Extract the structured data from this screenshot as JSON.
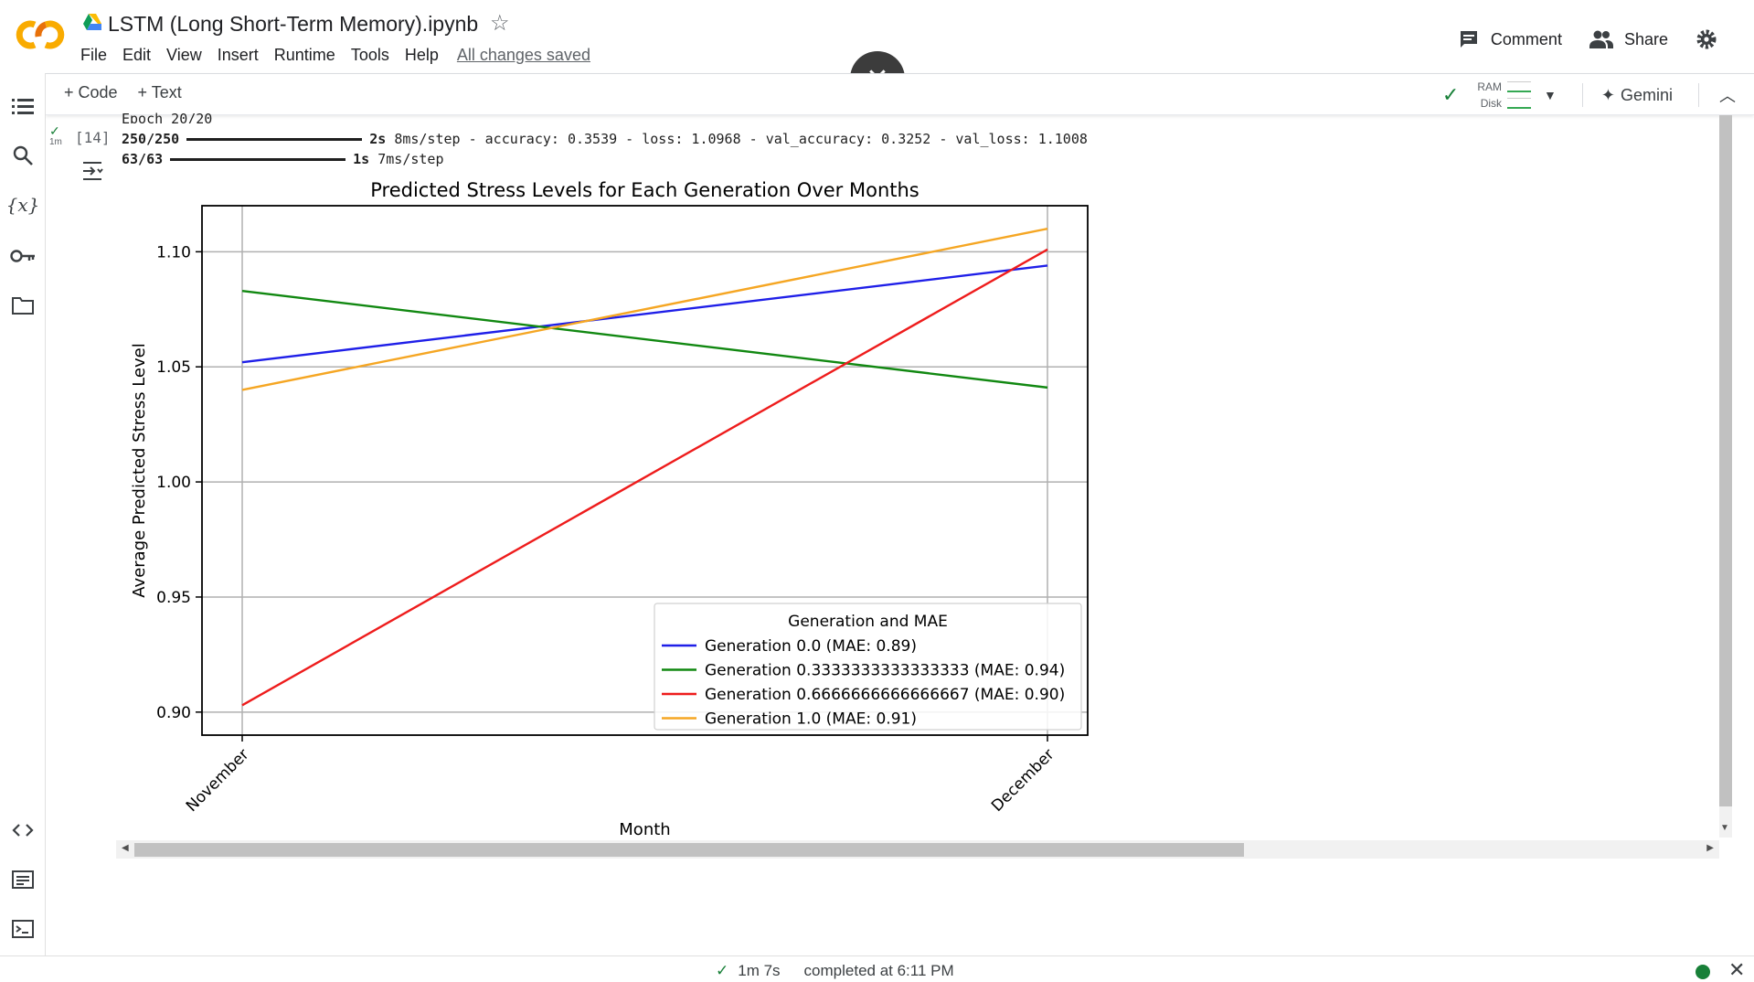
{
  "header": {
    "title": "LSTM (Long Short-Term Memory).ipynb",
    "menu": [
      "File",
      "Edit",
      "View",
      "Insert",
      "Runtime",
      "Tools",
      "Help"
    ],
    "saved_status": "All changes saved",
    "comment_label": "Comment",
    "share_label": "Share"
  },
  "toolbar": {
    "add_code": "+ Code",
    "add_text": "+ Text",
    "ram_label": "RAM",
    "disk_label": "Disk",
    "gemini_label": "Gemini"
  },
  "cell": {
    "run_time": "1m",
    "exec_count": "[14]",
    "epoch_line": "Epoch 20/20",
    "line1_steps": "250/250",
    "line1_time": "2s",
    "line1_rest": "8ms/step - accuracy: 0.3539 - loss: 1.0968 - val_accuracy: 0.3252 - val_loss: 1.1008",
    "line2_steps": "63/63",
    "line2_time": "1s",
    "line2_rest": "7ms/step"
  },
  "chart_data": {
    "type": "line",
    "title": "Predicted Stress Levels for Each Generation Over Months",
    "xlabel": "Month",
    "ylabel": "Average Predicted Stress Level",
    "categories": [
      "November",
      "December"
    ],
    "ylim": [
      0.89,
      1.12
    ],
    "yticks": [
      "0.90",
      "0.95",
      "1.00",
      "1.05",
      "1.10"
    ],
    "grid": true,
    "legend_title": "Generation and MAE",
    "legend_position": "lower-right",
    "series": [
      {
        "name": "Generation 0.0 (MAE: 0.89)",
        "color": "#1f1fe8",
        "values": [
          1.052,
          1.094
        ]
      },
      {
        "name": "Generation 0.3333333333333333 (MAE: 0.94)",
        "color": "#118811",
        "values": [
          1.083,
          1.041
        ]
      },
      {
        "name": "Generation 0.6666666666666667 (MAE: 0.90)",
        "color": "#ee1c1c",
        "values": [
          0.903,
          1.101
        ]
      },
      {
        "name": "Generation 1.0 (MAE: 0.91)",
        "color": "#f5a623",
        "values": [
          1.04,
          1.11
        ]
      }
    ]
  },
  "statusbar": {
    "duration": "1m 7s",
    "completed": "completed at 6:11 PM"
  }
}
